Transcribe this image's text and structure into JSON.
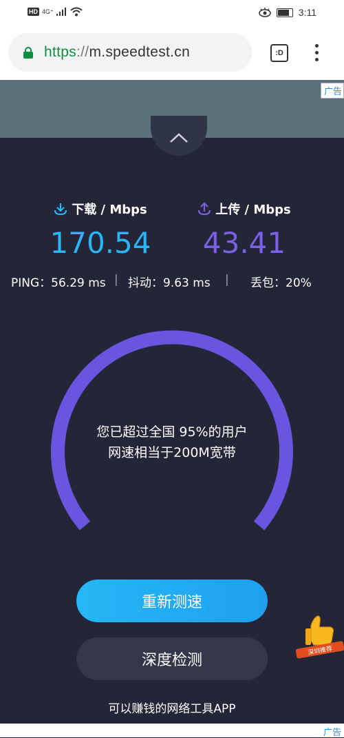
{
  "status_bar": {
    "hd": "HD",
    "network": "4G⁺",
    "time": "3:11"
  },
  "browser": {
    "url_scheme": "https",
    "url_sep": "://",
    "url_host": "m.speedtest.cn",
    "tab_label": ":D"
  },
  "ads": {
    "top_tag": "广告",
    "bottom_tag": "广告"
  },
  "metrics": {
    "download": {
      "label": "下载 / Mbps",
      "value": "170.54",
      "color": "#29b6f6"
    },
    "upload": {
      "label": "上传 / Mbps",
      "value": "43.41",
      "color": "#7b61e8"
    }
  },
  "stats": {
    "ping": "PING：56.29 ms",
    "jitter": "抖动：9.63 ms",
    "loss": "丢包：20%",
    "divider": "|"
  },
  "gauge": {
    "line1": "您已超过全国 95%的用户",
    "line2": "网速相当于200M宽带",
    "color": "#6a55e0"
  },
  "buttons": {
    "retest": "重新测速",
    "deep": "深度检测"
  },
  "footer": {
    "text": "可以赚钱的网络工具APP"
  },
  "promo": {
    "badge": "深圳推荐"
  }
}
